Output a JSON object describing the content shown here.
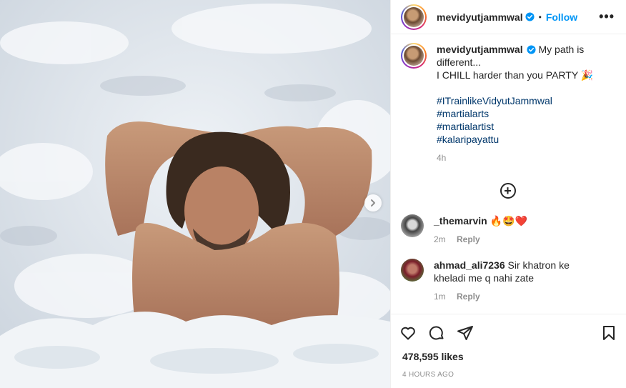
{
  "post": {
    "username": "mevidyutjammwal",
    "follow_label": "Follow",
    "separator": "•",
    "more_label": "•••",
    "caption": {
      "line1": "My path is different...",
      "line2": "I CHILL harder than you PARTY",
      "emoji": "🎉",
      "hashtags": [
        "#ITrainlikeVidyutJammwal",
        "#martialarts",
        "#martialartist",
        "#kalaripayattu"
      ],
      "time": "4h"
    },
    "load_more_symbol": "+",
    "comments": [
      {
        "username": "_themarvin",
        "text": "🔥🤩❤️",
        "time": "2m",
        "reply_label": "Reply"
      },
      {
        "username": "ahmad_ali7236",
        "text": "Sir khatron ke kheladi me q nahi zate",
        "time": "1m",
        "reply_label": "Reply"
      }
    ],
    "likes": "478,595 likes",
    "posted_ago": "4 HOURS AGO"
  },
  "colors": {
    "accent": "#0095f6",
    "hashtag": "#00376b",
    "muted": "#8e8e8e"
  },
  "icons": {
    "verified": "verified-badge-icon",
    "next": "chevron-right-icon",
    "like": "heart-icon",
    "comment": "comment-bubble-icon",
    "share": "paper-plane-icon",
    "save": "bookmark-icon",
    "load_more": "plus-circle-icon"
  }
}
